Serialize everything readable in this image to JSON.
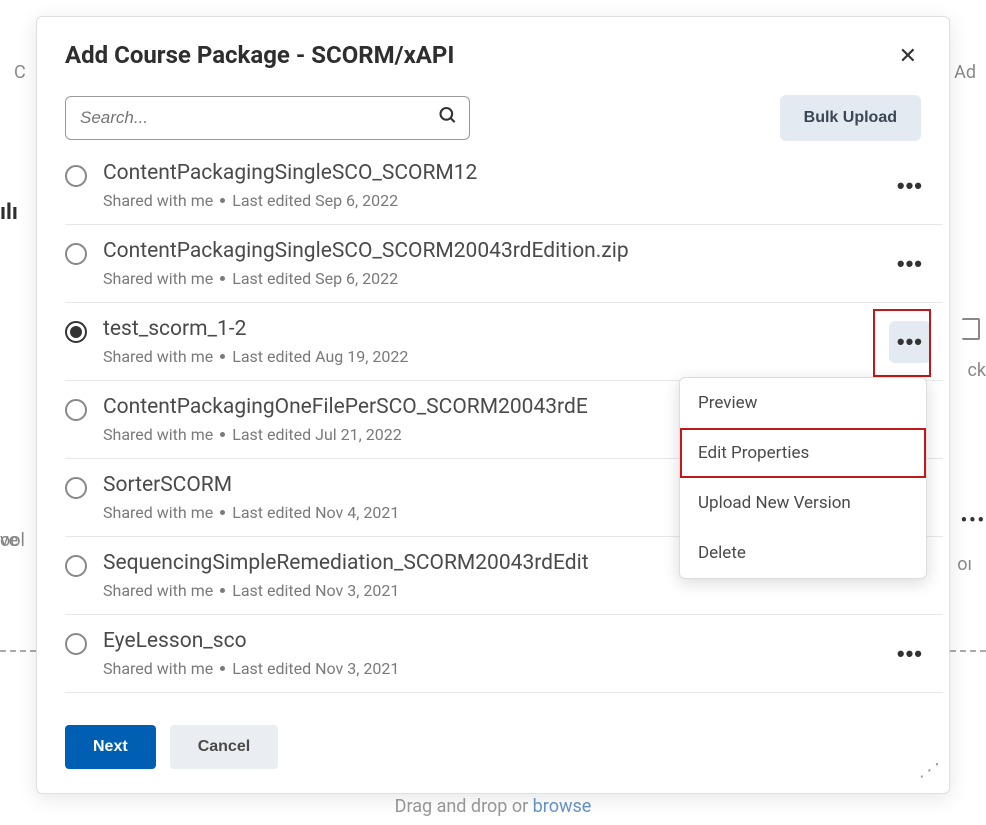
{
  "modal": {
    "title": "Add Course Package - SCORM/xAPI",
    "close_aria": "Close"
  },
  "search": {
    "placeholder": "Search..."
  },
  "toolbar": {
    "bulk_upload_label": "Bulk Upload"
  },
  "packages": [
    {
      "title": "ContentPackagingSingleSCO_SCORM12",
      "shared": "Shared with me",
      "edited": "Last edited Sep 6, 2022",
      "selected": false
    },
    {
      "title": "ContentPackagingSingleSCO_SCORM20043rdEdition.zip",
      "shared": "Shared with me",
      "edited": "Last edited Sep 6, 2022",
      "selected": false
    },
    {
      "title": "test_scorm_1-2",
      "shared": "Shared with me",
      "edited": "Last edited Aug 19, 2022",
      "selected": true
    },
    {
      "title": "ContentPackagingOneFilePerSCO_SCORM20043rdE",
      "shared": "Shared with me",
      "edited": "Last edited Jul 21, 2022",
      "selected": false
    },
    {
      "title": "SorterSCORM",
      "shared": "Shared with me",
      "edited": "Last edited Nov 4, 2021",
      "selected": false
    },
    {
      "title": "SequencingSimpleRemediation_SCORM20043rdEdit",
      "shared": "Shared with me",
      "edited": "Last edited Nov 3, 2021",
      "selected": false
    },
    {
      "title": "EyeLesson_sco",
      "shared": "Shared with me",
      "edited": "Last edited Nov 3, 2021",
      "selected": false
    }
  ],
  "dropdown": {
    "items": [
      {
        "label": "Preview"
      },
      {
        "label": "Edit Properties"
      },
      {
        "label": "Upload New Version"
      },
      {
        "label": "Delete"
      }
    ],
    "highlighted_index": 1
  },
  "footer": {
    "next_label": "Next",
    "cancel_label": "Cancel"
  },
  "behind": {
    "drag_text": "Drag and drop or ",
    "browse_text": "browse",
    "left1": "C",
    "left2": "ılı",
    "left3": "ve",
    "left4": "ool",
    "right1": "Ad",
    "right2": "ck",
    "right3": "•••",
    "right4": "oı"
  }
}
